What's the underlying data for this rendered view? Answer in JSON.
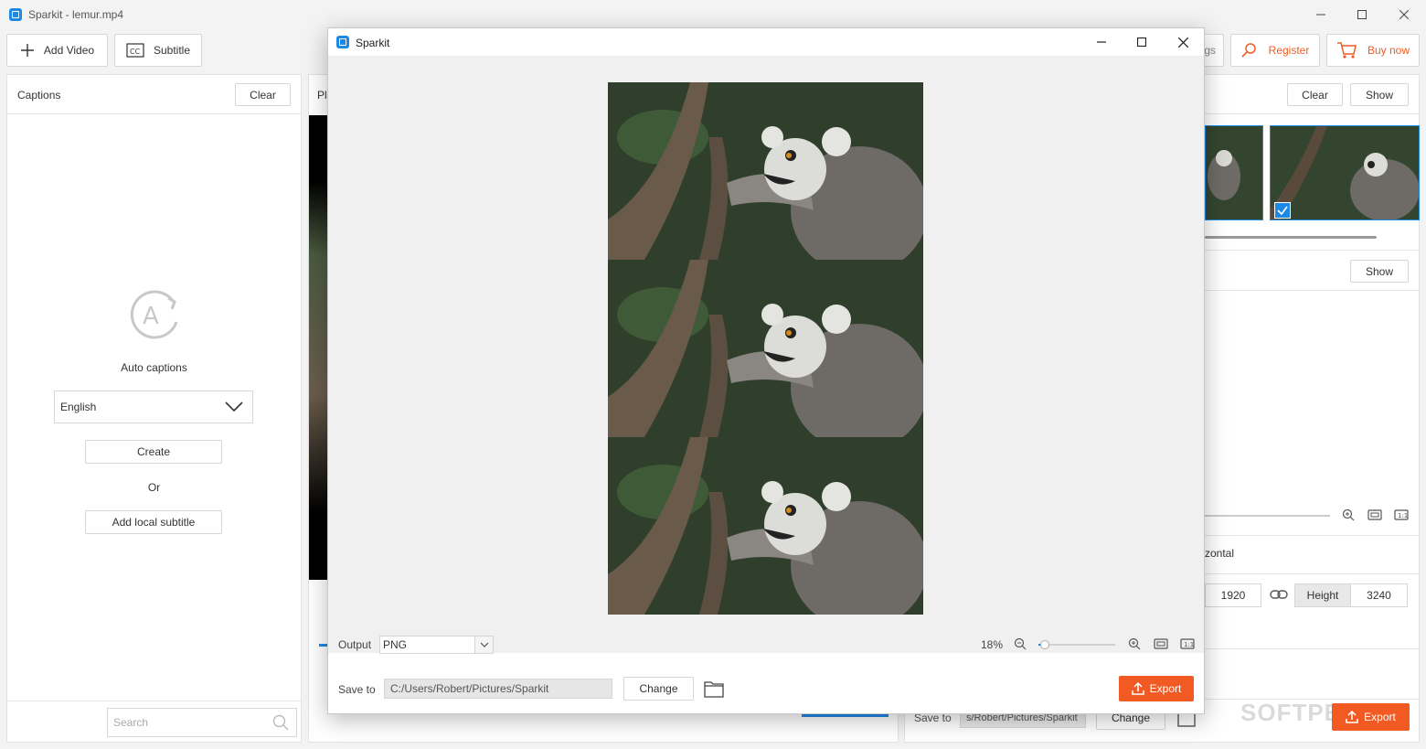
{
  "window": {
    "title": "Sparkit - lemur.mp4"
  },
  "toolbar": {
    "add_video": "Add Video",
    "subtitle": "Subtitle",
    "settings_partial": "gs",
    "register": "Register",
    "buy_now": "Buy now"
  },
  "captions": {
    "title": "Captions",
    "clear": "Clear",
    "auto_captions": "Auto captions",
    "language": "English",
    "create": "Create",
    "or": "Or",
    "add_local": "Add local subtitle",
    "search_placeholder": "Search"
  },
  "player": {
    "label_partial": "Pl"
  },
  "right": {
    "clear": "Clear",
    "show": "Show",
    "show2": "Show",
    "orientation_partial": "zontal",
    "width_value": "1920",
    "height_label": "Height",
    "height_value": "3240",
    "save_to_label": "Save to",
    "save_path": "s/Robert/Pictures/Sparkit",
    "change": "Change",
    "export": "Export",
    "watermark": "SOFTPEDIA"
  },
  "modal": {
    "title": "Sparkit",
    "output_label": "Output",
    "output_value": "PNG",
    "zoom_percent": "18%",
    "zoom_level": 0.05,
    "save_to_label": "Save to",
    "save_path": "C:/Users/Robert/Pictures/Sparkit",
    "change": "Change",
    "export": "Export"
  },
  "colors": {
    "accent": "#f15a22",
    "selection": "#1e88e5"
  }
}
